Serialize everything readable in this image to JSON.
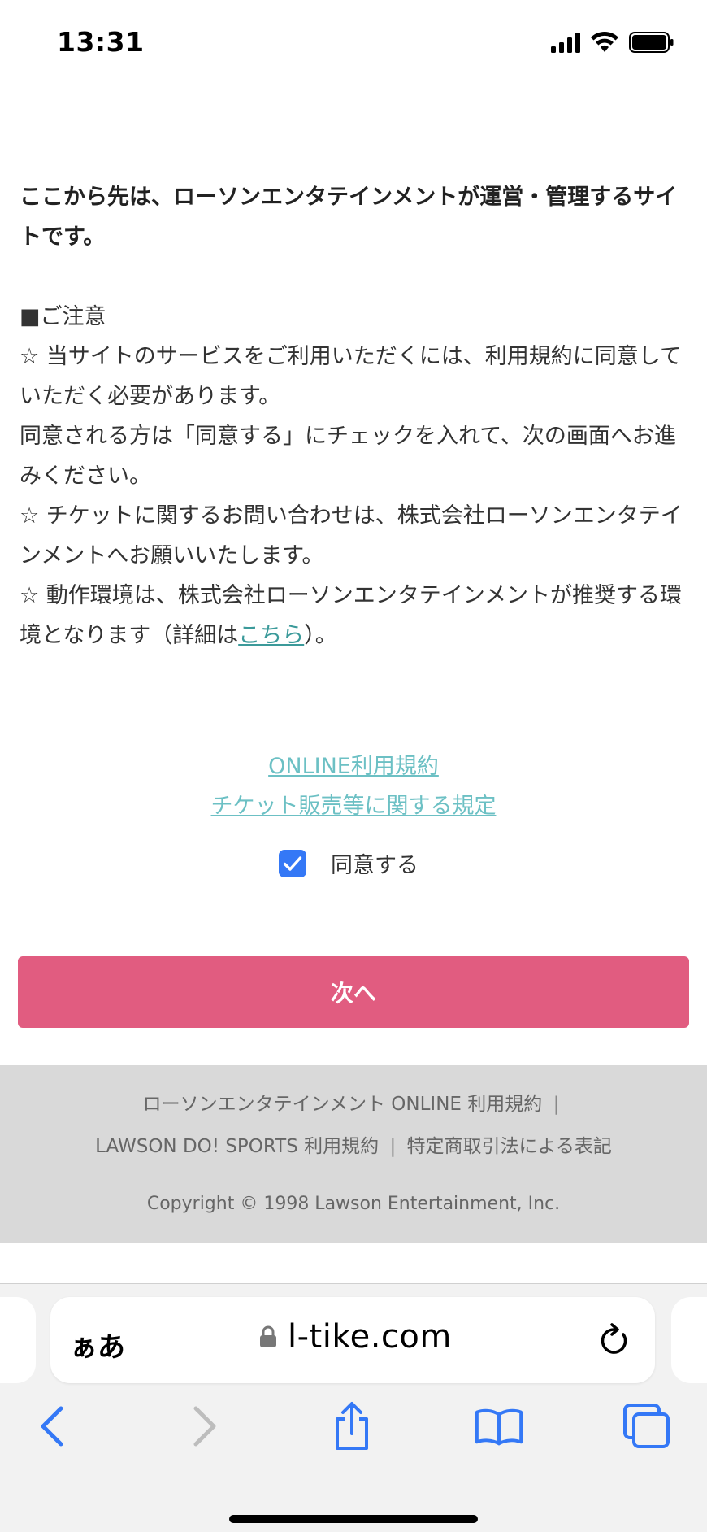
{
  "status_bar": {
    "time": "13:31"
  },
  "content": {
    "lead": "ここから先は、ローソンエンタテインメントが運営・管理するサイトです。",
    "notice_title": "■ご注意",
    "notice_1": "☆ 当サイトのサービスをご利用いただくには、利用規約に同意していただく必要があります。",
    "notice_2": "同意される方は「同意する」にチェックを入れて、次の画面へお進みください。",
    "notice_3": "☆ チケットに関するお問い合わせは、株式会社ローソンエンタテインメントへお願いいたします。",
    "notice_4_before": "☆ 動作環境は、株式会社ローソンエンタテインメントが推奨する環境となります（詳細は",
    "notice_4_link": "こちら",
    "notice_4_after": "）。"
  },
  "links": {
    "online_terms": "ONLINE利用規約",
    "ticket_rules": "チケット販売等に関する規定"
  },
  "agree": {
    "label": "同意する",
    "checked": true
  },
  "next_button": {
    "label": "次へ"
  },
  "footer": {
    "link_1": "ローソンエンタテインメント ONLINE 利用規約",
    "link_2": "LAWSON DO! SPORTS 利用規約",
    "link_3": "特定商取引法による表記",
    "separator": "|",
    "copyright": "Copyright © 1998 Lawson Entertainment, Inc."
  },
  "browser": {
    "aa_label": "ぁあ",
    "url": "l-tike.com"
  },
  "colors": {
    "accent_button": "#e15c80",
    "link": "#6cc0c4",
    "checkbox": "#3478f6",
    "toolbar_icon": "#3478f6",
    "footer_bg": "#d9d9d9"
  }
}
